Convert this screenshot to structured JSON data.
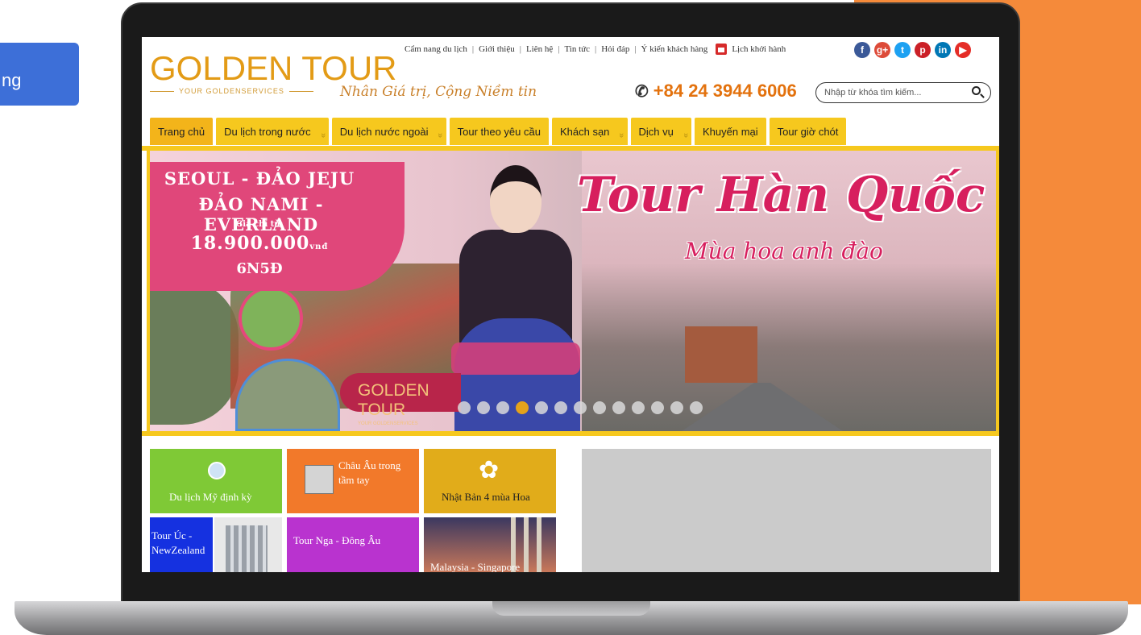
{
  "side_button": {
    "label": "ng"
  },
  "site": {
    "logo": {
      "main": "GOLDEN TOUR",
      "sub": "YOUR GOLDENSERVICES"
    },
    "slogan": "Nhân Giá trị, Cộng Niềm tin",
    "toplinks": [
      "Cẩm nang du lịch",
      "Giới thiệu",
      "Liên hệ",
      "Tin tức",
      "Hỏi đáp",
      "Ý kiến khách hàng",
      "Lịch khởi hành"
    ],
    "socials": [
      {
        "icon": "facebook-icon",
        "glyph": "f",
        "color": "#3b5998"
      },
      {
        "icon": "google-plus-icon",
        "glyph": "g+",
        "color": "#dd4b39"
      },
      {
        "icon": "twitter-icon",
        "glyph": "t",
        "color": "#1da1f2"
      },
      {
        "icon": "pinterest-icon",
        "glyph": "p",
        "color": "#cb2027"
      },
      {
        "icon": "linkedin-icon",
        "glyph": "in",
        "color": "#0077b5"
      },
      {
        "icon": "youtube-icon",
        "glyph": "▶",
        "color": "#e52d27"
      }
    ],
    "phone": "+84 24 3944 6006",
    "search_placeholder": "Nhập từ khóa tìm kiếm...",
    "nav": [
      {
        "label": "Trang chủ",
        "dropdown": false
      },
      {
        "label": "Du lịch trong nước",
        "dropdown": true
      },
      {
        "label": "Du lịch nước ngoài",
        "dropdown": true
      },
      {
        "label": "Tour theo yêu cầu",
        "dropdown": false
      },
      {
        "label": "Khách sạn",
        "dropdown": true
      },
      {
        "label": "Dịch vụ",
        "dropdown": true
      },
      {
        "label": "Khuyến mại",
        "dropdown": false
      },
      {
        "label": "Tour giờ chót",
        "dropdown": false
      }
    ],
    "banner": {
      "line1": "SEOUL - ĐẢO JEJU",
      "line2": "ĐẢO NAMI - EVERLAND",
      "price_label": "Giá chỉ từ:",
      "price": "18.900.000",
      "price_unit": "vnđ",
      "duration": "6N5Đ",
      "title": "Tour Hàn Quốc",
      "subtitle": "Mùa hoa anh đào",
      "badge": "GOLDEN TOUR",
      "badge_sub": "YOUR GOLDENSERVICES",
      "slide_count": 13,
      "active_slide": 4
    },
    "tiles": [
      {
        "label": "Du lịch Mỹ định kỳ",
        "color": "#7fc936"
      },
      {
        "label": "Châu Âu trong tầm tay",
        "color": "#f2792a"
      },
      {
        "label": "Nhật Bản 4 mùa Hoa",
        "color": "#e1ac1a"
      },
      {
        "label": "Tour Úc - NewZealand",
        "color": "#1531e0"
      },
      {
        "label": "Tour Nga - Đông Âu",
        "color": "#b933cf"
      },
      {
        "label": "Malaysia - Singapore",
        "color": "#3b3860"
      }
    ]
  }
}
